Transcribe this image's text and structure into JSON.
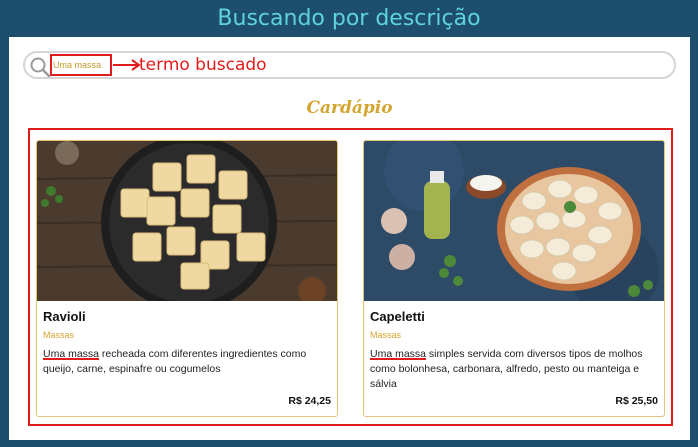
{
  "frame": {
    "title": "Buscando por descrição"
  },
  "search": {
    "term": "Uma massa",
    "annotation": "termo buscado",
    "icon": "search-icon"
  },
  "menu": {
    "title": "Cardápio",
    "items": [
      {
        "name": "Ravioli",
        "category": "Massas",
        "highlight": "Uma massa",
        "description_rest": " recheada com diferentes ingredientes como queijo, carne, espinafre ou cogumelos",
        "price": "R$ 24,25"
      },
      {
        "name": "Capeletti",
        "category": "Massas",
        "highlight": "Uma massa",
        "description_rest": " simples servida com diversos tipos de molhos como bolonhesa, carbonara, alfredo, pesto ou manteiga e sálvia",
        "price": "R$ 25,50"
      }
    ]
  },
  "colors": {
    "frame_bg": "#1d4e6c",
    "frame_title": "#5fd3da",
    "annotation_red": "#e21b1b",
    "accent_gold": "#d4a530"
  }
}
